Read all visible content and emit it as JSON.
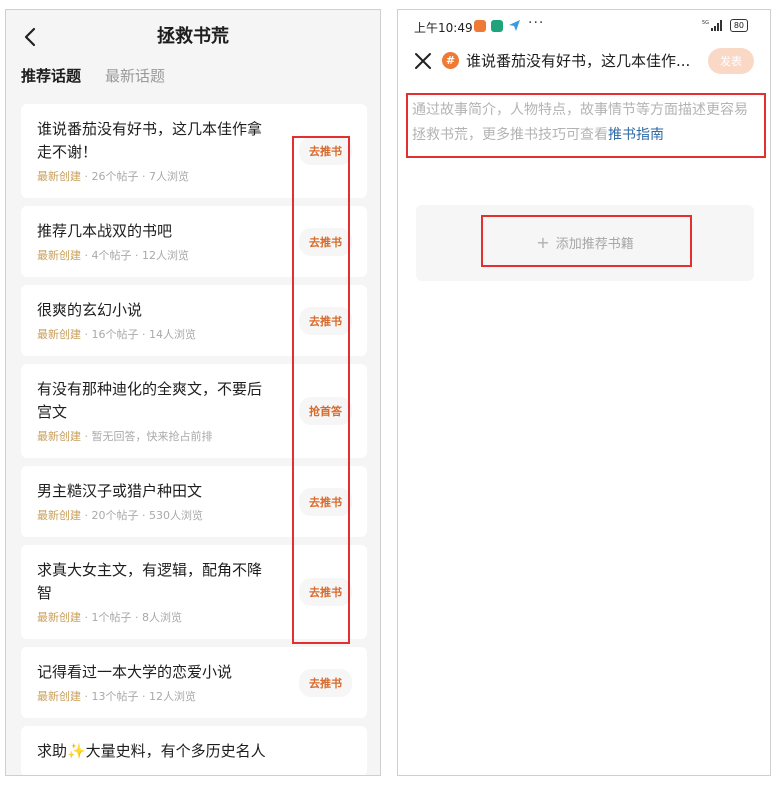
{
  "left": {
    "title": "拯救书荒",
    "tabs": [
      {
        "label": "推荐话题",
        "active": true
      },
      {
        "label": "最新话题",
        "active": false
      }
    ],
    "topics": [
      {
        "title": "谁说番茄没有好书，这几本佳作拿走不谢！",
        "tag": "最新创建",
        "meta": " · 26个帖子 · 7人浏览",
        "action": "去推书"
      },
      {
        "title": "推荐几本战双的书吧",
        "tag": "最新创建",
        "meta": " · 4个帖子 · 12人浏览",
        "action": "去推书"
      },
      {
        "title": "很爽的玄幻小说",
        "tag": "最新创建",
        "meta": " · 16个帖子 · 14人浏览",
        "action": "去推书"
      },
      {
        "title": "有没有那种迪化的全爽文，不要后宫文",
        "tag": "最新创建",
        "meta": " · 暂无回答，快来抢占前排",
        "action": "抢首答"
      },
      {
        "title": "男主糙汉子或猎户种田文",
        "tag": "最新创建",
        "meta": " · 20个帖子 · 530人浏览",
        "action": "去推书"
      },
      {
        "title": "求真大女主文，有逻辑，配角不降智",
        "tag": "最新创建",
        "meta": " · 1个帖子 · 8人浏览",
        "action": "去推书"
      },
      {
        "title": "记得看过一本大学的恋爱小说",
        "tag": "最新创建",
        "meta": " · 13个帖子 · 12人浏览",
        "action": "去推书"
      },
      {
        "title": "求助✨大量史料，有个多历史名人",
        "tag": "",
        "meta": "",
        "action": ""
      }
    ]
  },
  "right": {
    "status": {
      "time": "上午10:49",
      "more": "···",
      "network": "5G",
      "battery": "80"
    },
    "header_title": "谁说番茄没有好书，这几本佳作...",
    "hash_symbol": "#",
    "publish_label": "发表",
    "intro_text": "通过故事简介，人物特点，故事情节等方面描述更容易拯救书荒，更多推书技巧可查看",
    "intro_link": "推书指南",
    "add_book_label": "添加推荐书籍",
    "colors": {
      "accent": "#d86a2c",
      "tag": "#c89f5a",
      "link": "#2e6aa5",
      "highlight": "#e23030"
    }
  }
}
